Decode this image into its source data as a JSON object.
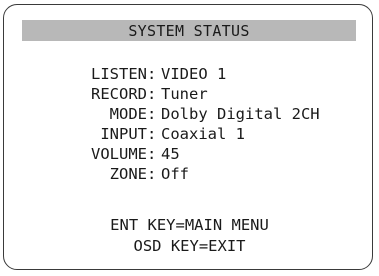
{
  "title": "SYSTEM STATUS",
  "rows": [
    {
      "label": "LISTEN",
      "value": "VIDEO 1"
    },
    {
      "label": "RECORD",
      "value": "Tuner"
    },
    {
      "label": "MODE",
      "value": "Dolby Digital 2CH"
    },
    {
      "label": "INPUT",
      "value": "Coaxial 1"
    },
    {
      "label": "VOLUME",
      "value": "45"
    },
    {
      "label": "ZONE",
      "value": "Off"
    }
  ],
  "footer": {
    "line1": "ENT KEY=MAIN MENU",
    "line2": "OSD KEY=EXIT"
  },
  "colors": {
    "title_bar": "#b8b8b8",
    "frame_border": "#3a3a3a",
    "text": "#1a1a1a",
    "background": "#ffffff"
  }
}
